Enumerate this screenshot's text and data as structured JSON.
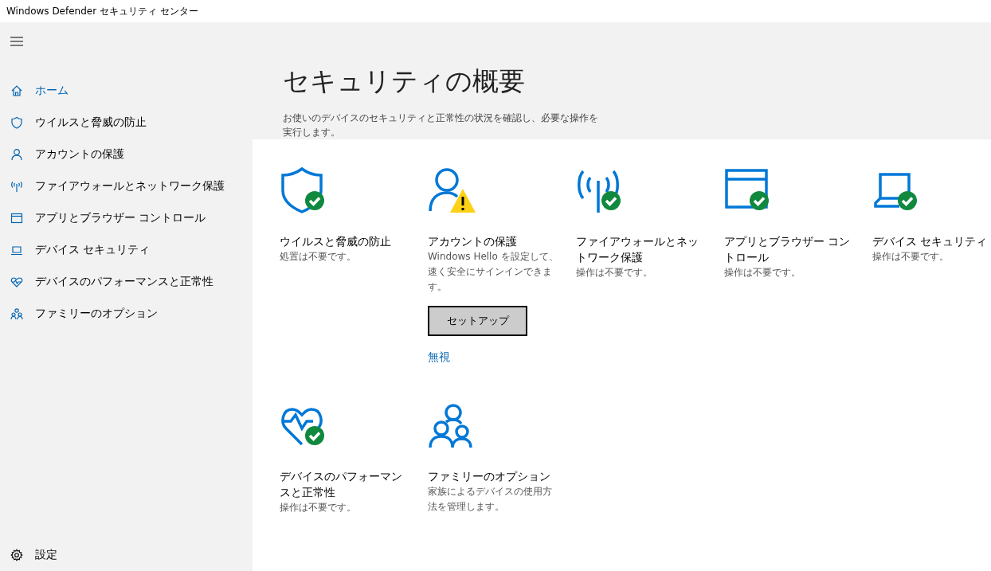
{
  "window": {
    "title": "Windows Defender セキュリティ センター"
  },
  "sidebar": {
    "items": [
      {
        "label": "ホーム",
        "kind": "home",
        "selected": true
      },
      {
        "label": "ウイルスと脅威の防止",
        "kind": "shield",
        "selected": false
      },
      {
        "label": "アカウントの保護",
        "kind": "person",
        "selected": false
      },
      {
        "label": "ファイアウォールとネットワーク保護",
        "kind": "antenna",
        "selected": false
      },
      {
        "label": "アプリとブラウザー コントロール",
        "kind": "browser",
        "selected": false
      },
      {
        "label": "デバイス セキュリティ",
        "kind": "laptop",
        "selected": false
      },
      {
        "label": "デバイスのパフォーマンスと正常性",
        "kind": "heart",
        "selected": false
      },
      {
        "label": "ファミリーのオプション",
        "kind": "family",
        "selected": false
      }
    ],
    "settings": {
      "label": "設定"
    }
  },
  "header": {
    "title": "セキュリティの概要",
    "description": "お使いのデバイスのセキュリティと正常性の状況を確認し、必要な操作を実行します。"
  },
  "tiles": [
    {
      "kind": "shield",
      "protected": true,
      "warning": false,
      "title": "ウイルスと脅威の防止",
      "description": "処置は不要です。"
    },
    {
      "kind": "person",
      "protected": false,
      "warning": true,
      "title": "アカウントの保護",
      "description": "Windows Hello を設定して、速く安全にサインインできます。",
      "button": "セットアップ",
      "link": "無視"
    },
    {
      "kind": "antenna",
      "protected": true,
      "warning": false,
      "title": "ファイアウォールとネットワーク保護",
      "description": "操作は不要です。"
    },
    {
      "kind": "browser",
      "protected": true,
      "warning": false,
      "title": "アプリとブラウザー コントロール",
      "description": "操作は不要です。"
    },
    {
      "kind": "laptop",
      "protected": true,
      "warning": false,
      "title": "デバイス セキュリティ",
      "description": "操作は不要です。"
    },
    {
      "kind": "heart",
      "protected": true,
      "warning": false,
      "title": "デバイスのパフォーマンスと正常性",
      "description": "操作は不要です。"
    },
    {
      "kind": "family",
      "protected": false,
      "warning": false,
      "title": "ファミリーのオプション",
      "description": "家族によるデバイスの使用方法を管理します。"
    }
  ]
}
